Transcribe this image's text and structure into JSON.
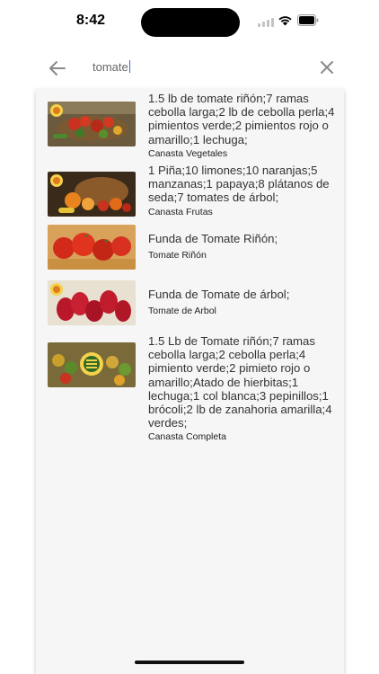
{
  "status": {
    "time": "8:42"
  },
  "search": {
    "query": "tomate"
  },
  "results": [
    {
      "title": "1.5 lb de tomate riñón;7 ramas cebolla larga;2 lb de cebolla perla;4 pimientos verde;2 pimientos rojo o amarillo;1 lechuga;",
      "subtitle": "Canasta Vegetales"
    },
    {
      "title": "1 Piña;10 limones;10 naranjas;5 manzanas;1 papaya;8 plátanos de seda;7 tomates de árbol;",
      "subtitle": "Canasta Frutas"
    },
    {
      "title": "Funda de Tomate Riñón;",
      "subtitle": "Tomate Riñón"
    },
    {
      "title": "Funda de Tomate de árbol;",
      "subtitle": "Tomate de Arbol"
    },
    {
      "title": "1.5  Lb de Tomate riñón;7 ramas cebolla larga;2 cebolla perla;4 pimiento verde;2 pimieto rojo o amarillo;Atado de hierbitas;1 lechuga;1 col blanca;3 pepinillos;1 brócoli;2 lb de zanahoria amarilla;4 verdes;",
      "subtitle": "Canasta Completa"
    }
  ]
}
